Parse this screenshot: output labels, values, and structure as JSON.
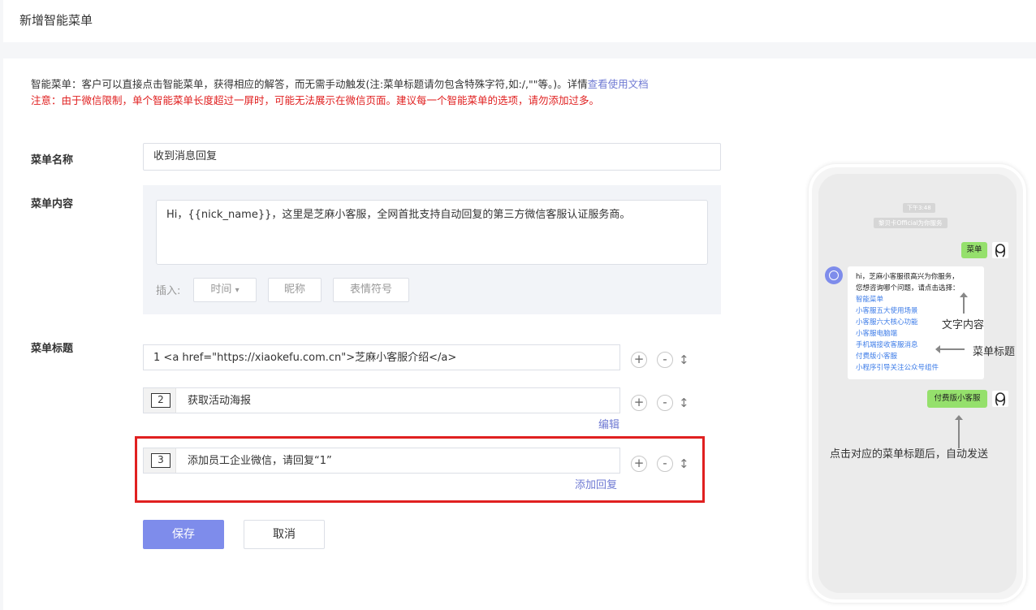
{
  "header": {
    "title": "新增智能菜单"
  },
  "description": {
    "text": "智能菜单：客户可以直接点击智能菜单，获得相应的解答，而无需手动触发(注:菜单标题请勿包含特殊字符,如:/,\"\"等。)。详情",
    "doc_link": "查看使用文档",
    "warning": "注意：由于微信限制，单个智能菜单长度超过一屏时，可能无法展示在微信页面。建议每一个智能菜单的选项，请勿添加过多。"
  },
  "form": {
    "name_label": "菜单名称",
    "name_value": "收到消息回复",
    "content_label": "菜单内容",
    "content_value": "Hi，{{nick_name}}，这里是芝麻小客服，全网首批支持自动回复的第三方微信客服认证服务商。",
    "insert_label": "插入:",
    "insert_time": "时间",
    "insert_nickname": "昵称",
    "insert_emoji": "表情符号",
    "title_label": "菜单标题",
    "rows": [
      {
        "number": "1",
        "text": "<a href=\"https://xiaokefu.com.cn\">芝麻小客服介绍</a>"
      },
      {
        "number": "2",
        "text": "获取活动海报",
        "link": "编辑"
      },
      {
        "number": "3",
        "text": "添加员工企业微信，请回复“1”",
        "link": "添加回复"
      }
    ],
    "save": "保存",
    "cancel": "取消"
  },
  "icons": {
    "plus": "+",
    "minus": "-",
    "sort": "↕",
    "caret": "▾"
  },
  "phone": {
    "time": "下午3:48",
    "system": "黎贝卡Official为你服务",
    "user_msg": "菜单",
    "bot_greeting_1": "hi，芝麻小客服很高兴为你服务，",
    "bot_greeting_2": "您想咨询哪个问题，请点击选择：",
    "menu_items": [
      "智能菜单",
      "小客服五大使用场景",
      "小客服六大核心功能",
      "小客服电脑端",
      "手机端接收客服消息",
      "付费版小客服",
      "小程序引导关注公众号组件"
    ],
    "user_click": "付费版小客服"
  },
  "annotations": {
    "text_content": "文字内容",
    "menu_title": "菜单标题",
    "auto_send": "点击对应的菜单标题后，自动发送"
  },
  "colors": {
    "accent": "#7e8ceb",
    "link": "#6f7ad3",
    "warning": "#e02020",
    "wechat_green": "#95e06c"
  }
}
